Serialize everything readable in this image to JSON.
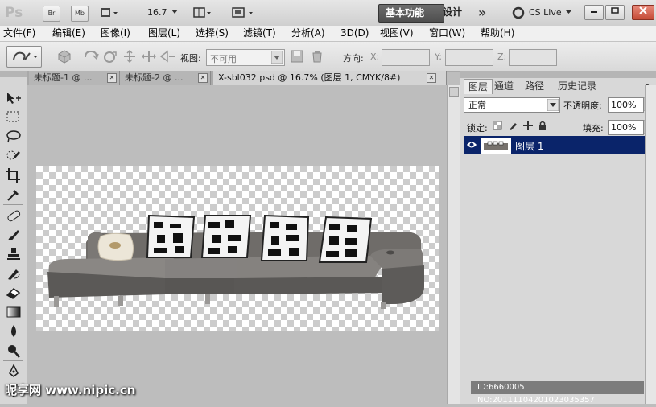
{
  "app": {
    "logo": "Ps",
    "bridge_label": "Br",
    "minibridge_label": "Mb",
    "zoom_level": "16.7",
    "workspace_essentials": "基本功能",
    "workspace_design": "设计",
    "more_label": "»",
    "cslive_label": "CS Live"
  },
  "menu": {
    "items": [
      "文件(F)",
      "编辑(E)",
      "图像(I)",
      "图层(L)",
      "选择(S)",
      "滤镜(T)",
      "分析(A)",
      "3D(D)",
      "视图(V)",
      "窗口(W)",
      "帮助(H)"
    ]
  },
  "options": {
    "view_label": "视图:",
    "view_value": "不可用",
    "direction_label": "方向:",
    "x_label": "X:",
    "y_label": "Y:",
    "z_label": "Z:"
  },
  "tabs": [
    {
      "label": "未标题-1 @ ..."
    },
    {
      "label": "未标题-2 @ ..."
    },
    {
      "label": "X-sbl032.psd @ 16.7% (图层 1, CMYK/8#)"
    }
  ],
  "panel": {
    "tabs": [
      "图层",
      "通道",
      "路径",
      "历史记录"
    ],
    "blend_mode": "正常",
    "opacity_label": "不透明度:",
    "opacity_value": "100%",
    "lock_label": "锁定:",
    "fill_label": "填充:",
    "fill_value": "100%",
    "layer_name": "图层 1"
  },
  "watermark": {
    "id_text": "ID:6660005 NO:20111104201023035357",
    "site_text": "昵享网 www.nipic.cn"
  },
  "colors": {
    "layer_selected": "#0a246a",
    "sofa": "#6e6b68"
  }
}
